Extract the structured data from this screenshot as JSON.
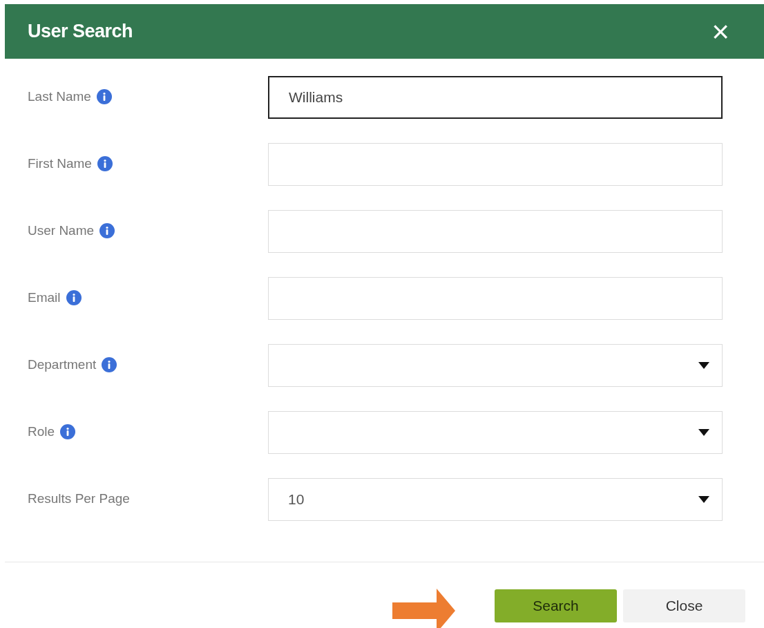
{
  "dialog": {
    "title": "User Search",
    "close_icon": "×"
  },
  "fields": [
    {
      "label": "Last Name",
      "info": true,
      "kind": "text",
      "value": "Williams",
      "focused": true
    },
    {
      "label": "First Name",
      "info": true,
      "kind": "text",
      "focused": false
    },
    {
      "label": "User Name",
      "info": true,
      "kind": "text",
      "focused": false
    },
    {
      "label": "Email",
      "info": true,
      "kind": "text",
      "focused": false
    },
    {
      "label": "Department",
      "info": true,
      "kind": "select",
      "focused": false
    },
    {
      "label": "Role",
      "info": true,
      "kind": "select",
      "focused": false
    },
    {
      "label": "Results Per Page",
      "info": false,
      "kind": "select",
      "value": "10",
      "focused": false
    }
  ],
  "buttons": [
    {
      "label": "Search",
      "kind": "primary"
    },
    {
      "label": "Close",
      "kind": "secondary"
    }
  ]
}
